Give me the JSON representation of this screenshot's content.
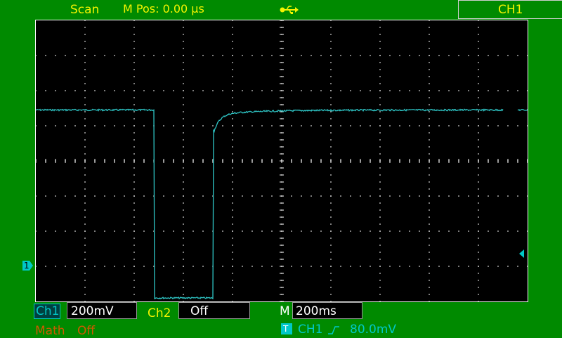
{
  "header": {
    "mode": "Scan",
    "mpos": "M Pos: 0.00 µs",
    "usb_icon": "usb-icon",
    "channel_tab": "CH1"
  },
  "footer": {
    "ch1_label": "Ch1",
    "ch1_scale": "200mV",
    "ch2_label": "Ch2",
    "ch2_scale": "Off",
    "timebase_label": "M",
    "timebase_value": "200ms",
    "math_label": "Math",
    "math_value": "Off",
    "trigger_badge": "T",
    "trigger_source": "CH1",
    "trigger_slope_icon": "rising-edge-icon",
    "trigger_level": "80.0mV"
  },
  "markers": {
    "ch1_ground": "1"
  },
  "colors": {
    "background": "#008a00",
    "screen": "#000000",
    "grid": "#ffffff",
    "trace": "#2ec4c4",
    "label_yellow": "#f3f300",
    "label_cyan": "#00c8c8",
    "label_orange": "#cc5a00"
  },
  "waveform": {
    "channel": "CH1",
    "volts_per_div": 0.2,
    "time_per_div": 0.2,
    "high_level_div": 1.45,
    "low_level_div": -3.9,
    "fall_time_div": -2.6,
    "rise_time_div": -1.4,
    "settle_tau_div": 0.12,
    "gap_start_div": 4.5,
    "gap_end_div": 4.8
  }
}
